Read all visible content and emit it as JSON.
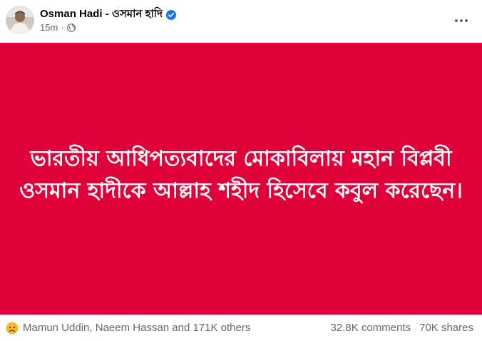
{
  "post": {
    "author": "Osman Hadi - ওসমান হাদি",
    "timestamp": "15m",
    "separator": "·",
    "status_text": "ভারতীয় আধিপত্যবাদের মোকাবিলায় মহান বিপ্লবী ওসমান হাদীকে আল্লাহ শহীদ হিসেবে কবুল করেছেন।",
    "background_color": "#e0003a"
  },
  "footer": {
    "reactions_text": "Mamun Uddin, Naeem Hassan and 171K others",
    "comments": "32.8K comments",
    "shares": "70K shares"
  },
  "icons": {
    "verified": "verified-badge-icon",
    "audience": "globe-icon",
    "more": "more-options-icon",
    "reaction": "sad-reaction-icon"
  }
}
